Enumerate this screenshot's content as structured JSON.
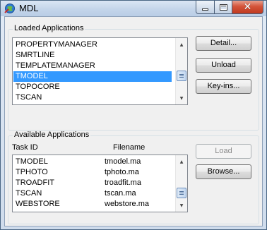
{
  "window": {
    "title": "MDL",
    "icon": "mdl-app-icon",
    "caption_buttons": [
      "minimize-icon",
      "maximize-icon",
      "close-icon"
    ],
    "close_glyph": "✕"
  },
  "loaded": {
    "group_label": "Loaded Applications",
    "items": [
      "PROPERTYMANAGER",
      "SMRTLINE",
      "TEMPLATEMANAGER",
      "TMODEL",
      "TOPOCORE",
      "TSCAN"
    ],
    "selected": "TMODEL",
    "buttons": {
      "detail": "Detail...",
      "unload": "Unload",
      "keyins": "Key-ins..."
    }
  },
  "available": {
    "group_label": "Available Applications",
    "columns": {
      "task_id": "Task ID",
      "filename": "Filename"
    },
    "rows": [
      {
        "task_id": "TMODEL",
        "filename": "tmodel.ma"
      },
      {
        "task_id": "TPHOTO",
        "filename": "tphoto.ma"
      },
      {
        "task_id": "TROADFIT",
        "filename": "troadfit.ma"
      },
      {
        "task_id": "TSCAN",
        "filename": "tscan.ma"
      },
      {
        "task_id": "WEBSTORE",
        "filename": "webstore.ma"
      }
    ],
    "buttons": {
      "load": "Load",
      "browse": "Browse..."
    }
  },
  "colors": {
    "selection": "#3399ff",
    "close_button": "#c7452a",
    "title_bar": "#c4d5ea"
  }
}
